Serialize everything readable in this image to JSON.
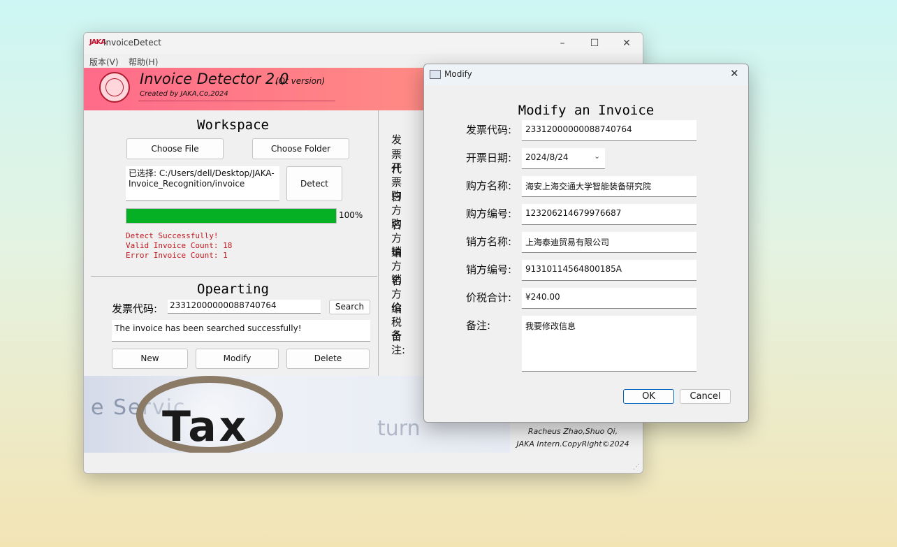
{
  "main_window": {
    "title": "InvoiceDetect",
    "icon_text": "JAKA",
    "menu": [
      "版本(V)",
      "帮助(H)"
    ],
    "banner": {
      "title": "Invoice Detector 2.0",
      "subtitle": "(Qt version)",
      "credit": "Created by JAKA,Co,2024"
    },
    "workspace": {
      "heading": "Workspace",
      "choose_file_label": "Choose File",
      "choose_folder_label": "Choose Folder",
      "path_text": "已选择: C:/Users/dell/Desktop/JAKA-Invoice_Recognition/invoice",
      "detect_label": "Detect",
      "progress_percent": 100,
      "progress_text": "100%",
      "status_lines": [
        "Detect Successfully!",
        "Valid Invoice Count: 18",
        "Error Invoice Count: 1"
      ]
    },
    "operating": {
      "heading": "Opearting",
      "code_label": "发票代码:",
      "code_value": "23312000000088740764",
      "search_label": "Search",
      "result_text": "The invoice has been searched successfully!",
      "new_label": "New",
      "modify_label": "Modify",
      "delete_label": "Delete"
    },
    "right_labels": [
      "发票代",
      "开票日",
      "购方名",
      "购方编",
      "销方名",
      "销方编",
      "价税合",
      "备注:"
    ],
    "footer": {
      "image_word_tax": "Tax",
      "image_word_service": "e Servic",
      "image_word_return": "turn",
      "credit_line1": "Racheus Zhao,Shuo Qi,",
      "credit_line2": "JAKA Intern.CopyRight©2024"
    }
  },
  "dialog": {
    "title": "Modify",
    "heading": "Modify an Invoice",
    "fields": [
      {
        "label": "发票代码:",
        "value": "23312000000088740764"
      },
      {
        "label": "开票日期:",
        "value": "2024/8/24"
      },
      {
        "label": "购方名称:",
        "value": "海安上海交通大学智能装备研究院"
      },
      {
        "label": "购方编号:",
        "value": "123206214679976687"
      },
      {
        "label": "销方名称:",
        "value": "上海泰迪贸易有限公司"
      },
      {
        "label": "销方编号:",
        "value": "91310114564800185A"
      },
      {
        "label": "价税合计:",
        "value": "¥240.00"
      },
      {
        "label": "备注:",
        "value": "我要修改信息"
      }
    ],
    "ok_label": "OK",
    "cancel_label": "Cancel"
  }
}
